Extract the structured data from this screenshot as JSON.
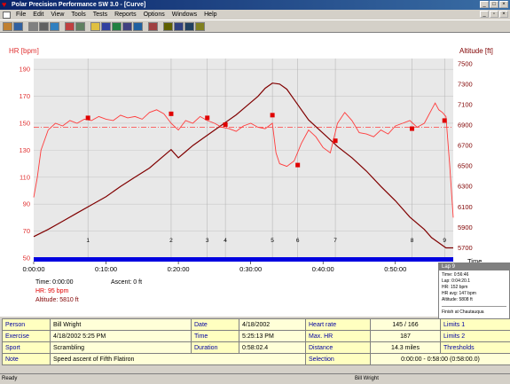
{
  "app": {
    "title": "Polar Precision Performance SW 3.0 - [Curve]"
  },
  "menu": [
    "File",
    "Edit",
    "View",
    "Tools",
    "Tests",
    "Reports",
    "Options",
    "Windows",
    "Help"
  ],
  "toolbar": {
    "buttons": [
      "open-icon",
      "save-icon",
      "print-icon",
      "preview-icon",
      "globe-icon",
      "calendar-icon",
      "settings-icon",
      "folder-icon",
      "chart-icon",
      "bar-chart-icon",
      "column-chart-icon",
      "zoom-icon",
      "person-icon",
      "group-icon",
      "group-stats-icon",
      "team-icon",
      "weekly-icon"
    ]
  },
  "chart_data": {
    "type": "line",
    "left_axis_label": "HR [bpm]",
    "right_axis_label": "Altitude [ft]",
    "x_axis_label": "Time",
    "hr_ticks": [
      50,
      70,
      90,
      110,
      130,
      150,
      170,
      190
    ],
    "alt_ticks": [
      5700,
      5900,
      6100,
      6300,
      6500,
      6700,
      6900,
      7100,
      7300,
      7500
    ],
    "time_ticks": [
      "0:00:00",
      "0:10:00",
      "0:20:00",
      "0:30:00",
      "0:40:00",
      "0:50:00"
    ],
    "xlim_min": [
      0,
      58
    ],
    "hr_lim": [
      50,
      198
    ],
    "alt_lim": [
      5600,
      7550
    ],
    "avg_hr": 147,
    "colors": {
      "hr": "#ff3c3c",
      "altitude": "#800000",
      "lap_band": "#0000e0"
    },
    "series": [
      {
        "name": "HR",
        "x": [
          0,
          0.5,
          1,
          2,
          3,
          4,
          5,
          6,
          7,
          8,
          9,
          10,
          11,
          12,
          13,
          14,
          15,
          16,
          17,
          18,
          19,
          20,
          21,
          22,
          23,
          24,
          25,
          26,
          27,
          28,
          29,
          30,
          31,
          32,
          33,
          33.5,
          34,
          35,
          36,
          37,
          38,
          39,
          40,
          41,
          42,
          43,
          44,
          45,
          46,
          47,
          48,
          49,
          50,
          51,
          52,
          53,
          54,
          55,
          55.5,
          56,
          56.5,
          57,
          57.5,
          58
        ],
        "values": [
          95,
          110,
          130,
          145,
          150,
          148,
          152,
          150,
          153,
          152,
          155,
          153,
          152,
          156,
          154,
          155,
          153,
          158,
          160,
          157,
          150,
          145,
          152,
          150,
          155,
          152,
          150,
          147,
          146,
          144,
          148,
          150,
          147,
          146,
          150,
          128,
          120,
          118,
          122,
          135,
          145,
          140,
          132,
          128,
          150,
          158,
          152,
          143,
          142,
          140,
          145,
          142,
          148,
          150,
          152,
          147,
          150,
          160,
          165,
          160,
          158,
          155,
          120,
          80
        ]
      },
      {
        "name": "Altitude",
        "x": [
          0,
          2,
          4,
          6,
          8,
          10,
          12,
          14,
          16,
          18,
          19,
          20,
          21,
          22,
          24,
          26,
          28,
          30,
          31,
          32,
          33,
          34,
          35,
          36,
          37,
          38,
          40,
          42,
          44,
          46,
          48,
          50,
          52,
          54,
          55,
          56,
          57,
          58
        ],
        "values": [
          5810,
          5880,
          5960,
          6040,
          6120,
          6200,
          6300,
          6390,
          6480,
          6600,
          6660,
          6580,
          6640,
          6700,
          6800,
          6900,
          7000,
          7120,
          7180,
          7260,
          7310,
          7300,
          7250,
          7150,
          7050,
          6950,
          6820,
          6690,
          6580,
          6450,
          6300,
          6160,
          6000,
          5880,
          5800,
          5750,
          5700,
          5700
        ]
      }
    ],
    "laps": [
      {
        "label": "1",
        "t": 7.5,
        "hr": 154
      },
      {
        "label": "2",
        "t": 19,
        "hr": 157
      },
      {
        "label": "3",
        "t": 24,
        "hr": 154
      },
      {
        "label": "4",
        "t": 26.5,
        "hr": 149
      },
      {
        "label": "5",
        "t": 33,
        "hr": 156
      },
      {
        "label": "6",
        "t": 36.5,
        "hr": 119
      },
      {
        "label": "7",
        "t": 41.7,
        "hr": 137
      },
      {
        "label": "8",
        "t": 52.3,
        "hr": 146
      },
      {
        "label": "9",
        "t": 56.8,
        "hr": 152
      }
    ]
  },
  "cursor": {
    "time_label": "Time: 0:00:00",
    "ascent_label": "Ascent: 0 ft",
    "hr_label": "HR: 95 bpm",
    "altitude_label": "Altitude: 5810 ft"
  },
  "lap_tooltip": {
    "title": "Lap 9",
    "lines": [
      "Time: 0:56:46",
      "Lap: 0:04:20.1",
      "HR: 152 bpm",
      "HR avg: 147 bpm",
      "Altitude: 5808 ft"
    ],
    "note": "Finish at Chautauqua"
  },
  "info": {
    "person_label": "Person",
    "person": "Bill Wright",
    "date_label": "Date",
    "date": "4/18/2002",
    "heart_rate_label": "Heart rate",
    "heart_rate": "145 / 166",
    "limits1_label": "Limits 1",
    "exercise_label": "Exercise",
    "exercise": "4/18/2002 5:25 PM",
    "time_label": "Time",
    "time": "5:25:13 PM",
    "max_hr_label": "Max. HR",
    "max_hr": "187",
    "limits2_label": "Limits 2",
    "sport_label": "Sport",
    "sport": "Scrambling",
    "duration_label": "Duration",
    "duration": "0:58:02.4",
    "distance_label": "Distance",
    "distance": "14.3 miles",
    "thresholds_label": "Thresholds",
    "note_label": "Note",
    "note": "Speed ascent of Fifth Flatiron",
    "selection_label": "Selection",
    "selection": "0:00:00 - 0:58:00 (0:58:00.0)"
  },
  "status": {
    "left": "Ready",
    "user": "Bill Wright"
  }
}
